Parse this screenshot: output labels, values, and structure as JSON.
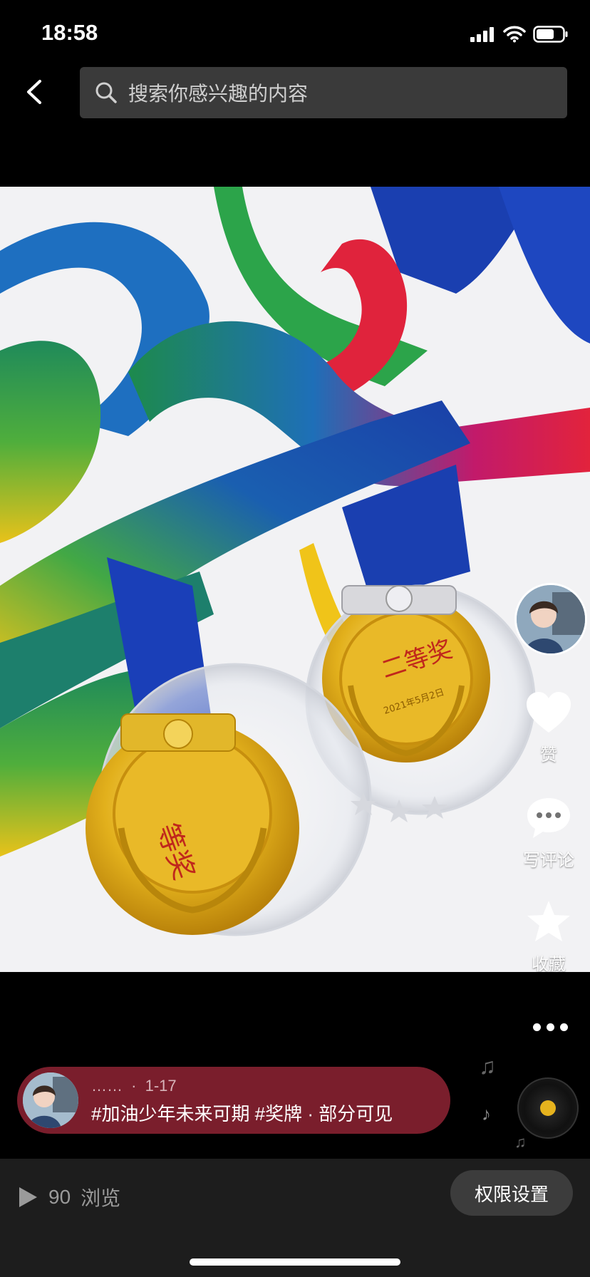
{
  "status_bar": {
    "time": "18:58"
  },
  "search": {
    "placeholder": "搜索你感兴趣的内容"
  },
  "post": {
    "medal_text_1": "二等奖",
    "medal_date": "2021年5月2日",
    "medal_text_2": "等奖"
  },
  "actions": {
    "like_label": "赞",
    "comment_label": "写评论",
    "favorite_label": "收藏"
  },
  "caption": {
    "author": "……",
    "separator": "·",
    "date": "1-17",
    "text": "#加油少年未来可期 #奖牌 · 部分可见"
  },
  "bottom": {
    "views_count": "90",
    "views_label": "浏览",
    "permission_button": "权限设置"
  }
}
